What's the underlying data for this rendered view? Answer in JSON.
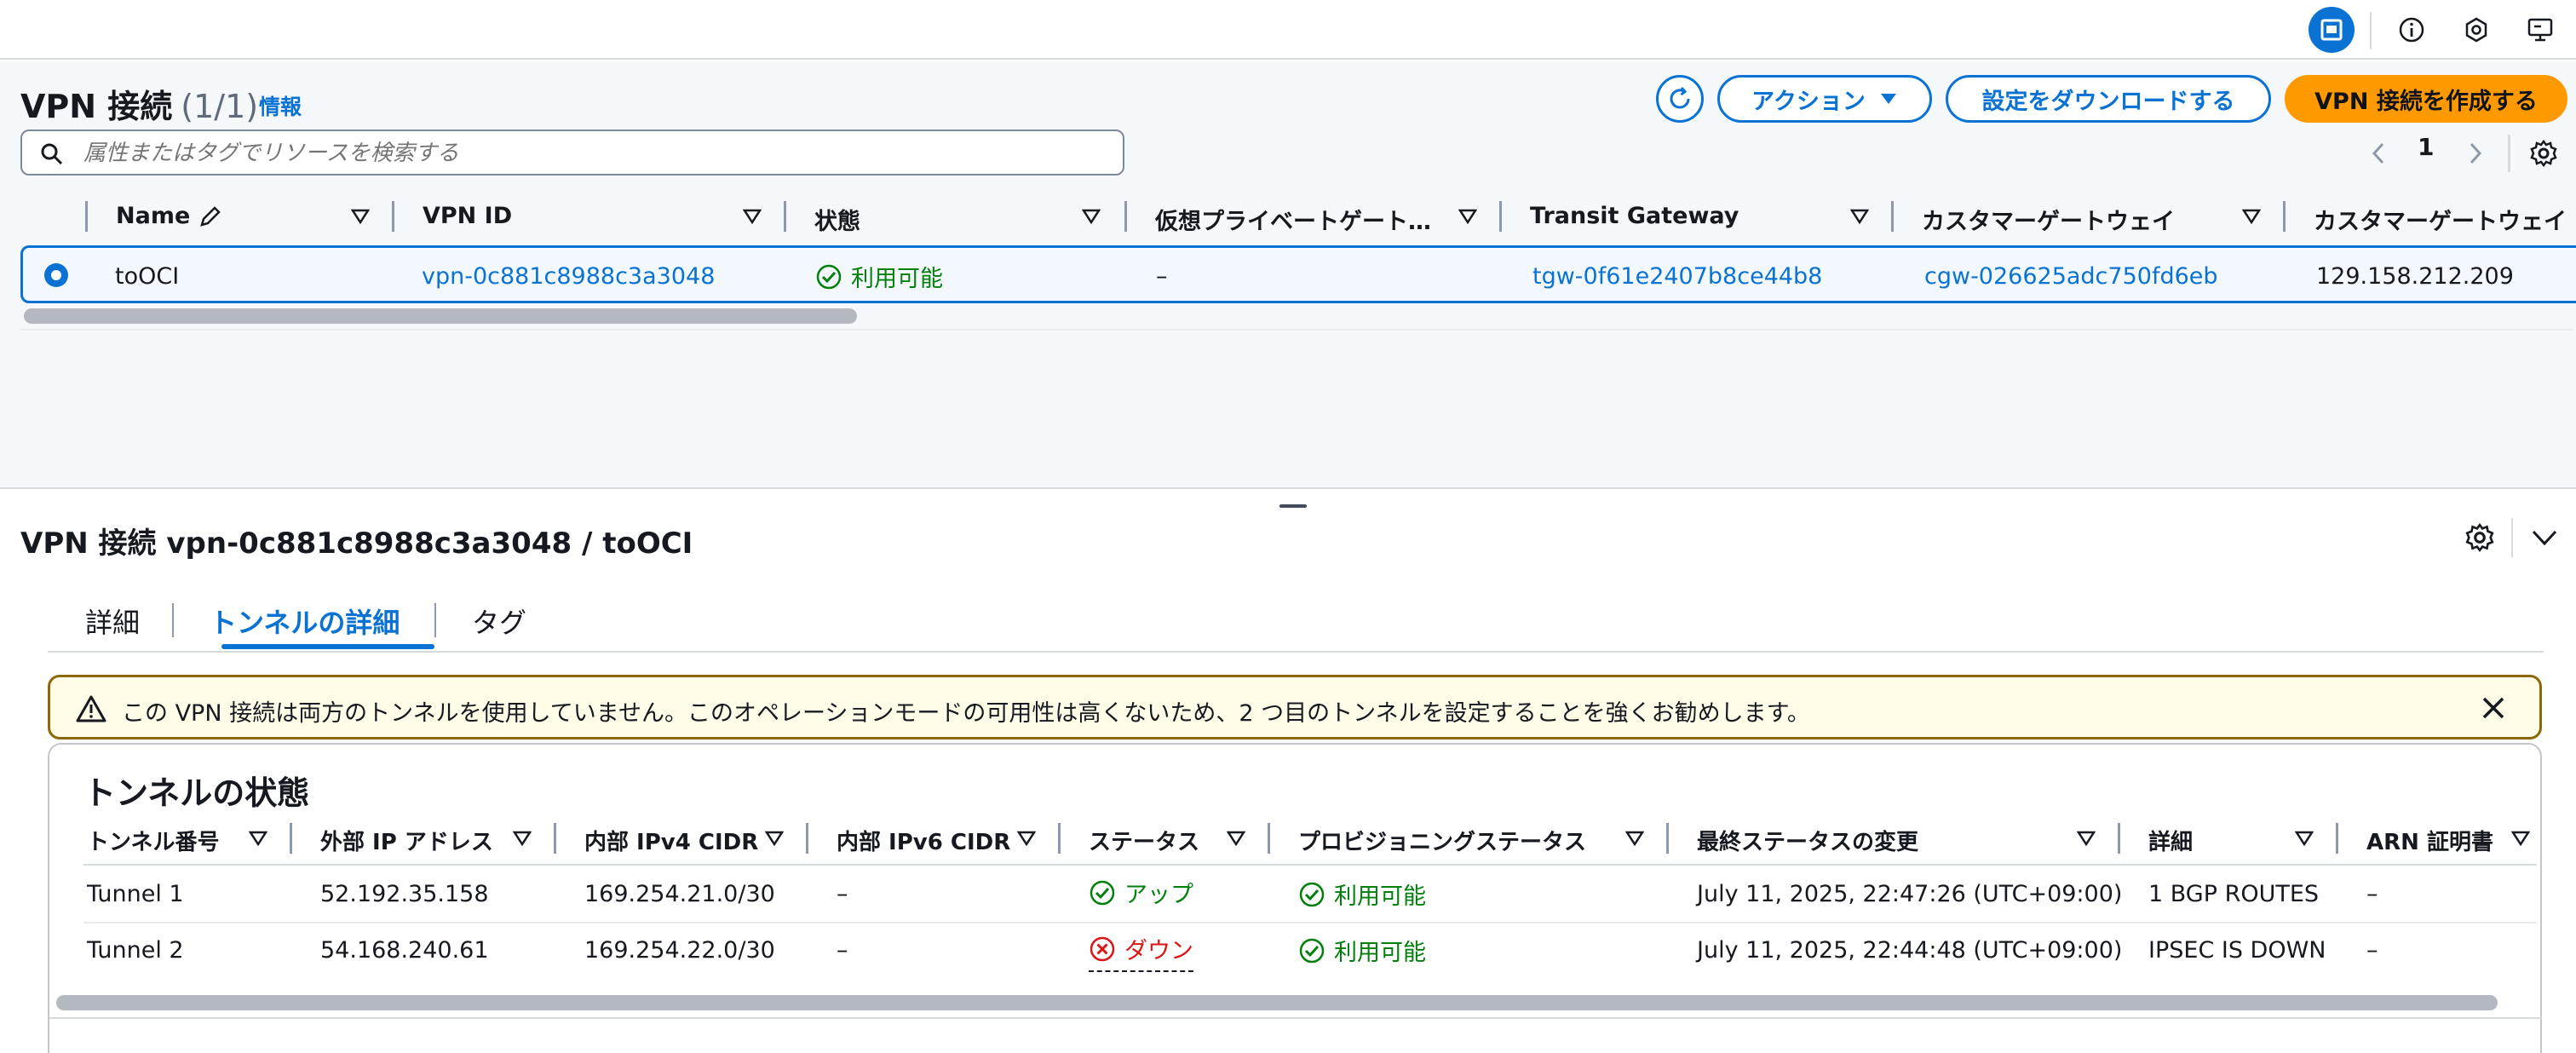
{
  "topbar": {
    "icons": [
      "layout-mode-icon",
      "info-icon",
      "hexagon-icon",
      "screen-icon"
    ]
  },
  "vpn_list": {
    "title": "VPN 接続",
    "count": "(1/1)",
    "info": "情報",
    "buttons": {
      "actions": "アクション",
      "download": "設定をダウンロードする",
      "create": "VPN 接続を作成する"
    },
    "search_placeholder": "属性またはタグでリソースを検索する",
    "page": "1",
    "columns": [
      "Name",
      "VPN ID",
      "状態",
      "仮想プライベートゲート…",
      "Transit Gateway",
      "カスタマーゲートウェイ",
      "カスタマーゲートウェイ"
    ],
    "row": {
      "name": "toOCI",
      "vpn_id": "vpn-0c881c8988c3a3048",
      "state": "利用可能",
      "vgw": "–",
      "tgw": "tgw-0f61e2407b8ce44b8",
      "cgw": "cgw-026625adc750fd6eb",
      "cgw_ip": "129.158.212.209"
    }
  },
  "details": {
    "title": "VPN 接続 vpn-0c881c8988c3a3048 / toOCI",
    "tabs": [
      "詳細",
      "トンネルの詳細",
      "タグ"
    ],
    "alert": "この VPN 接続は両方のトンネルを使用していません。このオペレーションモードの可用性は高くないため、2 つ目のトンネルを設定することを強くお勧めします。",
    "tunnel_title": "トンネルの状態",
    "columns": [
      "トンネル番号",
      "外部 IP アドレス",
      "内部 IPv4 CIDR",
      "内部 IPv6 CIDR",
      "ステータス",
      "プロビジョニングステータス",
      "最終ステータスの変更",
      "詳細",
      "ARN 証明書"
    ],
    "rows": [
      {
        "tunnel": "Tunnel 1",
        "outside_ip": "52.192.35.158",
        "inside_ipv4": "169.254.21.0/30",
        "inside_ipv6": "–",
        "status": "アップ",
        "provisioning": "利用可能",
        "last_change": "July 11, 2025, 22:47:26 (UTC+09:00)",
        "detail": "1 BGP ROUTES",
        "arn": "–"
      },
      {
        "tunnel": "Tunnel 2",
        "outside_ip": "54.168.240.61",
        "inside_ipv4": "169.254.22.0/30",
        "inside_ipv6": "–",
        "status": "ダウン",
        "provisioning": "利用可能",
        "last_change": "July 11, 2025, 22:44:48 (UTC+09:00)",
        "detail": "IPSEC IS DOWN",
        "arn": "–"
      }
    ]
  },
  "colors": {
    "link": "#0972d3",
    "success": "#037f0c",
    "error": "#d91515",
    "primary_button": "#ff9900",
    "warning_border": "#8d6605"
  }
}
